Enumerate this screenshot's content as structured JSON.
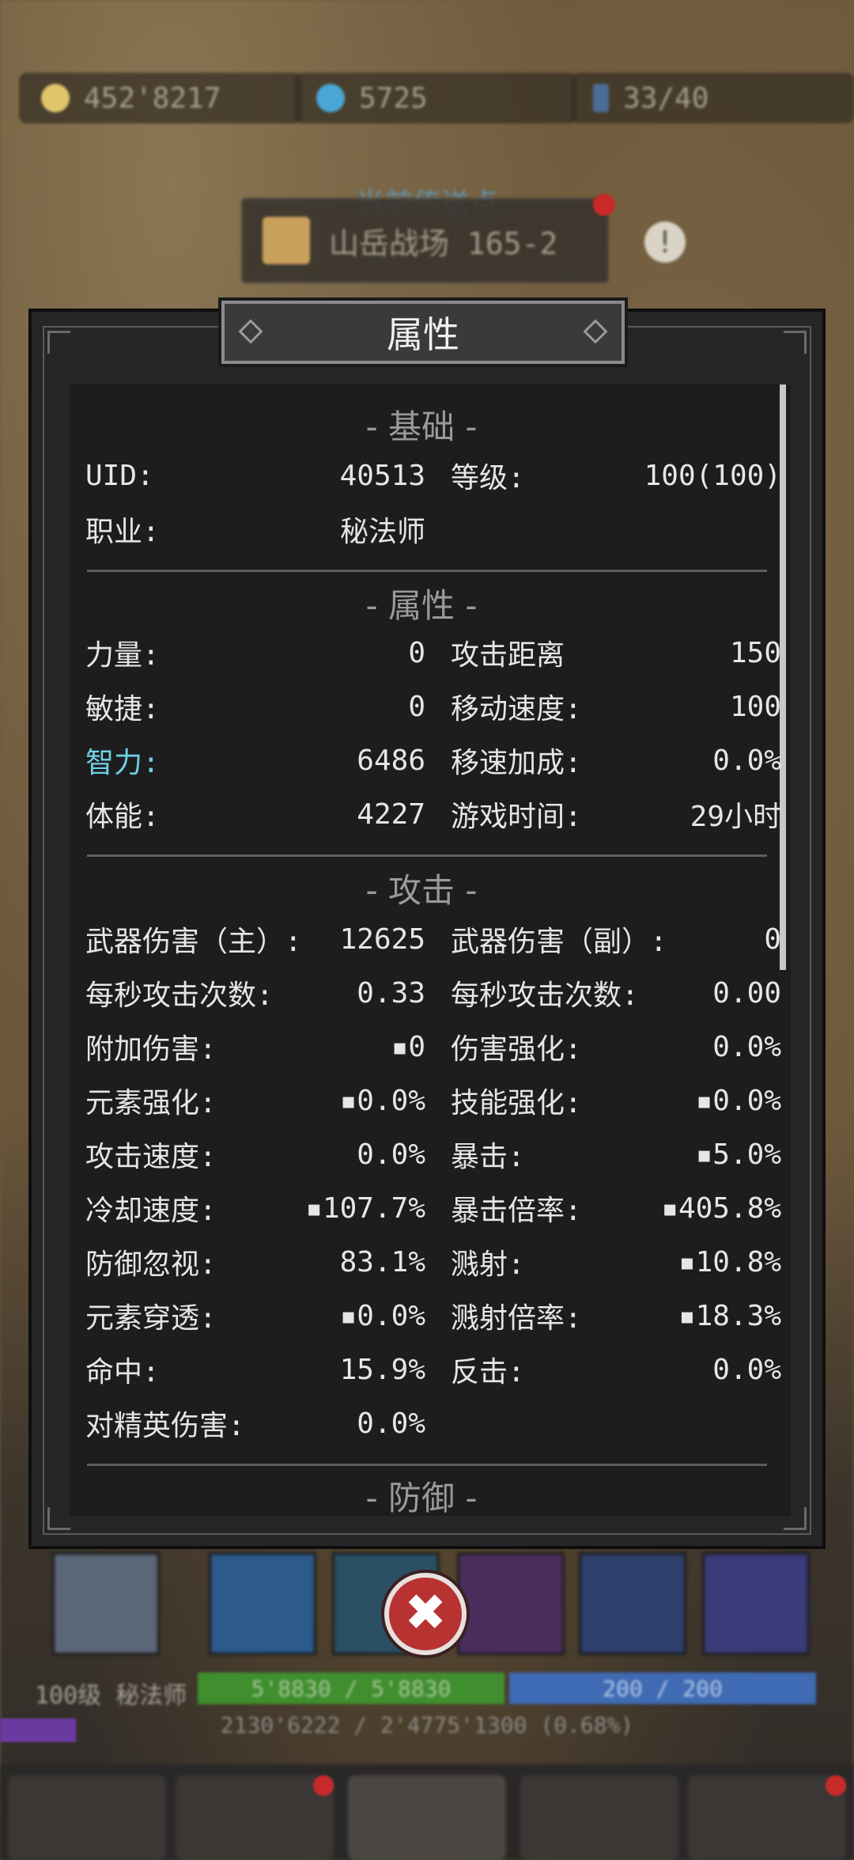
{
  "currencies": [
    {
      "icon": "gold-coin-icon",
      "value": "452'8217"
    },
    {
      "icon": "blue-gem-icon",
      "value": "5725"
    },
    {
      "icon": "stamina-icon",
      "value": "33/40"
    }
  ],
  "portal": {
    "caption": "当前传送点",
    "name": "山岳战场 165-2"
  },
  "dialog": {
    "title": "属性",
    "sections": {
      "basic": "- 基础 -",
      "attributes": "- 属性 -",
      "attack": "- 攻击 -",
      "defense": "- 防御 -"
    },
    "basic": {
      "uid_label": "UID:",
      "uid_value": "40513",
      "level_label": "等级:",
      "level_value": "100(100)",
      "job_label": "职业:",
      "job_value": "秘法师"
    },
    "attributes": [
      {
        "l_label": "力量:",
        "l_value": "0",
        "r_label": "攻击距离",
        "r_value": "150"
      },
      {
        "l_label": "敏捷:",
        "l_value": "0",
        "r_label": "移动速度:",
        "r_value": "100"
      },
      {
        "l_label": "智力:",
        "l_value": "6486",
        "r_label": "移速加成:",
        "r_value": "0.0%"
      },
      {
        "l_label": "体能:",
        "l_value": "4227",
        "r_label": "游戏时间:",
        "r_value": "29小时"
      }
    ],
    "attack": [
      {
        "l_label": "武器伤害（主）:",
        "l_value": "12625",
        "r_label": "武器伤害（副）:",
        "r_value": "0"
      },
      {
        "l_label": "每秒攻击次数:",
        "l_value": "0.33",
        "r_label": "每秒攻击次数:",
        "r_value": "0.00"
      },
      {
        "l_label": "附加伤害:",
        "l_value": "▪0",
        "r_label": "伤害强化:",
        "r_value": "0.0%"
      },
      {
        "l_label": "元素强化:",
        "l_value": "▪0.0%",
        "r_label": "技能强化:",
        "r_value": "▪0.0%"
      },
      {
        "l_label": "攻击速度:",
        "l_value": "0.0%",
        "r_label": "暴击:",
        "r_value": "▪5.0%"
      },
      {
        "l_label": "冷却速度:",
        "l_value": "▪107.7%",
        "r_label": "暴击倍率:",
        "r_value": "▪405.8%"
      },
      {
        "l_label": "防御忽视:",
        "l_value": "83.1%",
        "r_label": "溅射:",
        "r_value": "▪10.8%"
      },
      {
        "l_label": "元素穿透:",
        "l_value": "▪0.0%",
        "r_label": "溅射倍率:",
        "r_value": "▪18.3%"
      },
      {
        "l_label": "命中:",
        "l_value": "15.9%",
        "r_label": "反击:",
        "r_value": "0.0%"
      },
      {
        "l_label": "对精英伤害:",
        "l_value": "0.0%",
        "r_label": "",
        "r_value": ""
      }
    ]
  },
  "hud": {
    "level_job": "100级 秘法师",
    "hp": "5'8830 / 5'8830",
    "mp": "200 / 200",
    "exp": "2130'6222 / 2'4775'1300 (0.68%)",
    "exp_progress": 0.0068
  },
  "colors": {
    "highlight": "#6fd0e6",
    "hp_bar": "#3f8f2e",
    "mp_bar": "#3e6bb3",
    "close_button": "#b83232"
  }
}
